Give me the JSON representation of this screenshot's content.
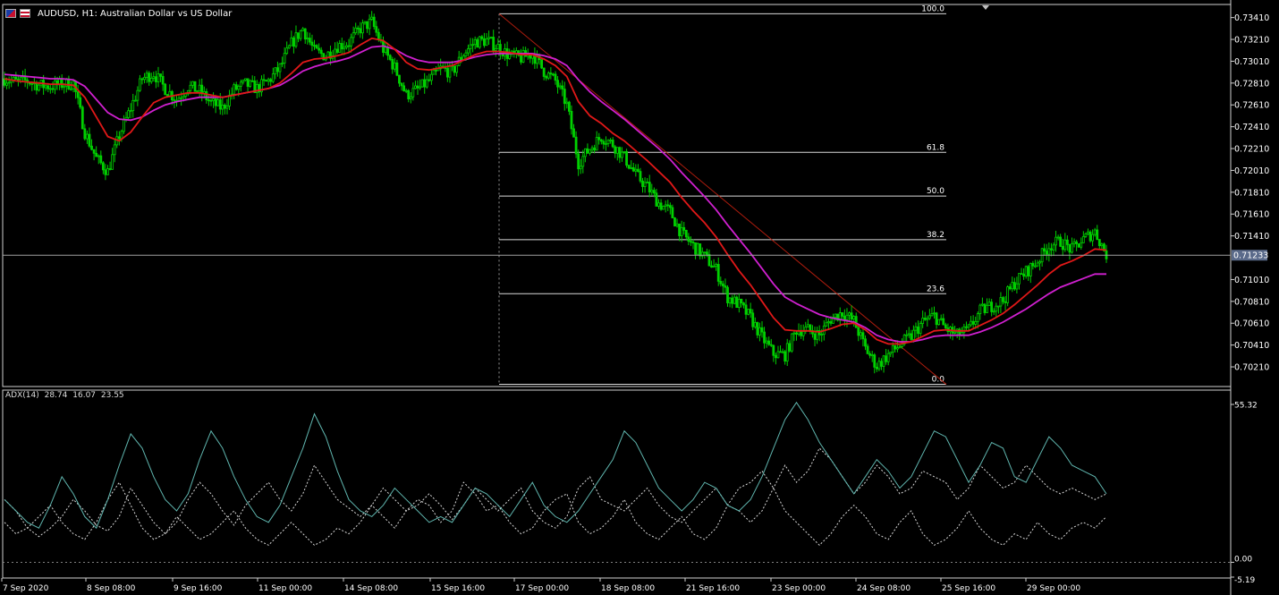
{
  "window": {
    "symbol_title": "AUDUSD, H1:  Australian Dollar vs US Dollar",
    "flag_icons": [
      "au-flag-icon",
      "us-flag-icon"
    ]
  },
  "indicator": {
    "name": "ADX(14)",
    "values": [
      "28.74",
      "16.07",
      "23.55"
    ],
    "scale_max": "55.32",
    "scale_zero": "0.00",
    "scale_negative": "-5.19"
  },
  "colors": {
    "background": "#000000",
    "candle": "#00d000",
    "ma_fast": "#e01818",
    "ma_slow": "#d020d0",
    "fib": "#ffffff",
    "trendline": "#c02010",
    "adx_main": "#5fb5ae",
    "adx_dotted": "#d8d8d8"
  },
  "chart_data": {
    "type": "line",
    "price_axis_labels": [
      "0.73410",
      "0.73210",
      "0.73010",
      "0.72810",
      "0.72610",
      "0.72410",
      "0.72210",
      "0.72010",
      "0.71810",
      "0.71610",
      "0.71410",
      "0.71010",
      "0.70810",
      "0.70610",
      "0.70410",
      "0.70210"
    ],
    "price_axis_range": [
      0.7003,
      0.7353
    ],
    "current_price_label": "0.71233",
    "current_price": 0.71233,
    "time_axis_labels": [
      "7 Sep 2020",
      "8 Sep 08:00",
      "9 Sep 16:00",
      "11 Sep 00:00",
      "14 Sep 08:00",
      "15 Sep 16:00",
      "17 Sep 00:00",
      "18 Sep 08:00",
      "21 Sep 16:00",
      "23 Sep 00:00",
      "24 Sep 08:00",
      "25 Sep 16:00",
      "29 Sep 00:00"
    ],
    "price_path": [
      0.7285,
      0.7282,
      0.7283,
      0.7279,
      0.7278,
      0.728,
      0.7281,
      0.7236,
      0.7212,
      0.72,
      0.7233,
      0.7258,
      0.7285,
      0.729,
      0.7276,
      0.7266,
      0.7278,
      0.7274,
      0.7263,
      0.7258,
      0.7275,
      0.728,
      0.7276,
      0.7283,
      0.7295,
      0.7317,
      0.7331,
      0.731,
      0.7306,
      0.7315,
      0.7318,
      0.7331,
      0.7337,
      0.7312,
      0.7295,
      0.727,
      0.7275,
      0.7283,
      0.7294,
      0.7291,
      0.7308,
      0.7319,
      0.732,
      0.7314,
      0.7306,
      0.7304,
      0.7308,
      0.7292,
      0.7283,
      0.7261,
      0.7208,
      0.7221,
      0.7232,
      0.7225,
      0.7213,
      0.7197,
      0.7186,
      0.7171,
      0.7163,
      0.7143,
      0.7132,
      0.7122,
      0.711,
      0.7085,
      0.7078,
      0.7066,
      0.7048,
      0.7033,
      0.7032,
      0.7055,
      0.7055,
      0.705,
      0.7065,
      0.7071,
      0.7063,
      0.7038,
      0.7022,
      0.7032,
      0.7041,
      0.7049,
      0.7062,
      0.7068,
      0.7056,
      0.705,
      0.7055,
      0.7072,
      0.7077,
      0.7082,
      0.7098,
      0.7108,
      0.7118,
      0.7132,
      0.7136,
      0.7128,
      0.7138,
      0.7145,
      0.7124
    ],
    "ma_fast": [
      0.7285,
      0.7283,
      0.7282,
      0.7281,
      0.728,
      0.728,
      0.7279,
      0.7268,
      0.725,
      0.7232,
      0.7228,
      0.7236,
      0.725,
      0.7263,
      0.7268,
      0.727,
      0.7272,
      0.7272,
      0.727,
      0.7268,
      0.727,
      0.7272,
      0.7274,
      0.7276,
      0.7281,
      0.729,
      0.73,
      0.7303,
      0.7304,
      0.7306,
      0.7309,
      0.7316,
      0.7322,
      0.732,
      0.7312,
      0.73,
      0.7294,
      0.7293,
      0.7295,
      0.7297,
      0.7302,
      0.7307,
      0.731,
      0.731,
      0.7309,
      0.7307,
      0.7307,
      0.7303,
      0.7297,
      0.7287,
      0.7264,
      0.7251,
      0.7244,
      0.7235,
      0.7228,
      0.7219,
      0.721,
      0.72,
      0.719,
      0.7176,
      0.7164,
      0.7153,
      0.714,
      0.7124,
      0.7109,
      0.7096,
      0.7081,
      0.7066,
      0.7055,
      0.7054,
      0.7054,
      0.7053,
      0.7056,
      0.706,
      0.7061,
      0.7055,
      0.7046,
      0.7042,
      0.7042,
      0.7044,
      0.7049,
      0.7054,
      0.7055,
      0.7054,
      0.7054,
      0.7059,
      0.7064,
      0.707,
      0.7078,
      0.7087,
      0.7096,
      0.7106,
      0.7114,
      0.7118,
      0.7123,
      0.7129,
      0.7128
    ],
    "ma_slow": [
      0.7289,
      0.7288,
      0.7287,
      0.7286,
      0.7285,
      0.7285,
      0.7284,
      0.7278,
      0.7266,
      0.7254,
      0.7248,
      0.7247,
      0.725,
      0.7256,
      0.7261,
      0.7264,
      0.7266,
      0.7268,
      0.7268,
      0.7268,
      0.727,
      0.7272,
      0.7274,
      0.7276,
      0.7279,
      0.7285,
      0.7292,
      0.7296,
      0.7299,
      0.7301,
      0.7304,
      0.7309,
      0.7314,
      0.7315,
      0.7312,
      0.7306,
      0.7302,
      0.73,
      0.73,
      0.73,
      0.7302,
      0.7305,
      0.7307,
      0.7308,
      0.7308,
      0.7308,
      0.7308,
      0.7306,
      0.7303,
      0.7297,
      0.7284,
      0.7273,
      0.7264,
      0.7256,
      0.7248,
      0.7239,
      0.723,
      0.7221,
      0.7211,
      0.7199,
      0.7188,
      0.7177,
      0.7165,
      0.7151,
      0.7138,
      0.7125,
      0.7111,
      0.7097,
      0.7085,
      0.7079,
      0.7074,
      0.7069,
      0.7066,
      0.7064,
      0.7062,
      0.7057,
      0.705,
      0.7046,
      0.7044,
      0.7044,
      0.7046,
      0.7049,
      0.705,
      0.705,
      0.705,
      0.7053,
      0.7057,
      0.7062,
      0.7068,
      0.7074,
      0.7081,
      0.7088,
      0.7094,
      0.7098,
      0.7102,
      0.7106,
      0.7106
    ],
    "fibonacci": [
      {
        "label": "100.0",
        "price": 0.73445
      },
      {
        "label": "61.8",
        "price": 0.72175
      },
      {
        "label": "50.0",
        "price": 0.71775
      },
      {
        "label": "38.2",
        "price": 0.71375
      },
      {
        "label": "23.6",
        "price": 0.7088
      },
      {
        "label": "0.0",
        "price": 0.7005
      }
    ],
    "adx_range": [
      -5.19,
      55.32
    ],
    "adx_main": [
      22,
      18,
      14,
      12,
      20,
      30,
      24,
      16,
      12,
      22,
      34,
      45,
      40,
      30,
      22,
      18,
      24,
      36,
      46,
      40,
      30,
      22,
      16,
      14,
      20,
      30,
      40,
      52,
      44,
      32,
      22,
      18,
      16,
      20,
      26,
      22,
      18,
      14,
      16,
      14,
      20,
      26,
      24,
      20,
      16,
      22,
      28,
      20,
      16,
      14,
      18,
      24,
      30,
      36,
      46,
      42,
      34,
      26,
      22,
      18,
      22,
      28,
      26,
      20,
      18,
      22,
      30,
      40,
      50,
      56,
      50,
      42,
      36,
      30,
      24,
      30,
      36,
      32,
      26,
      30,
      38,
      46,
      44,
      36,
      28,
      34,
      42,
      40,
      30,
      28,
      36,
      44,
      40,
      34,
      32,
      30,
      24
    ],
    "adx_plus_di": [
      22,
      18,
      12,
      9,
      12,
      16,
      22,
      18,
      13,
      11,
      16,
      26,
      20,
      14,
      10,
      14,
      22,
      28,
      24,
      18,
      13,
      20,
      24,
      28,
      22,
      18,
      24,
      34,
      28,
      22,
      19,
      16,
      20,
      26,
      22,
      18,
      20,
      24,
      20,
      15,
      20,
      26,
      22,
      18,
      22,
      26,
      18,
      14,
      12,
      16,
      26,
      30,
      22,
      20,
      18,
      22,
      26,
      20,
      16,
      14,
      18,
      22,
      26,
      20,
      18,
      14,
      18,
      26,
      34,
      28,
      32,
      40,
      36,
      30,
      24,
      28,
      34,
      30,
      24,
      26,
      32,
      30,
      28,
      22,
      26,
      34,
      30,
      26,
      28,
      34,
      30,
      26,
      24,
      26,
      24,
      22,
      24
    ],
    "adx_minus_di": [
      14,
      10,
      12,
      16,
      20,
      14,
      10,
      8,
      14,
      22,
      28,
      20,
      12,
      8,
      10,
      16,
      12,
      8,
      10,
      14,
      18,
      12,
      8,
      6,
      10,
      14,
      10,
      6,
      8,
      12,
      10,
      14,
      20,
      16,
      12,
      18,
      22,
      20,
      14,
      18,
      28,
      24,
      18,
      20,
      14,
      10,
      12,
      18,
      22,
      24,
      14,
      10,
      12,
      16,
      22,
      14,
      10,
      8,
      12,
      16,
      10,
      8,
      12,
      20,
      26,
      28,
      32,
      26,
      18,
      14,
      10,
      6,
      10,
      16,
      20,
      16,
      10,
      8,
      14,
      18,
      10,
      6,
      8,
      12,
      18,
      12,
      8,
      6,
      10,
      8,
      14,
      10,
      8,
      12,
      14,
      12,
      16
    ]
  }
}
